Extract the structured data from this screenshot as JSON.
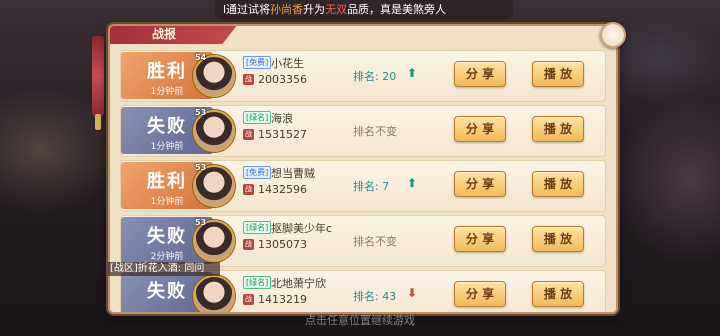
{
  "marquee": {
    "prefix": "l通过试",
    "middle": "将",
    "hero": "孙尚香",
    "mid2": "升为",
    "quality": "无双",
    "suffix": "品质，真是美煞旁人"
  },
  "panel": {
    "title": "战报"
  },
  "reports": [
    {
      "result": "胜利",
      "time": "1分钟前",
      "type": "win",
      "level": "54",
      "tag": "[免费]",
      "tag_color": "blue",
      "name": "小花生",
      "power": "2003356",
      "rank_text": "排名: 20",
      "rank_change": "up",
      "arrow": "⬆",
      "share": "分 享",
      "play": "播 放"
    },
    {
      "result": "失败",
      "time": "1分钟前",
      "type": "lose",
      "level": "53",
      "tag": "[绿名]",
      "tag_color": "green",
      "name": "海浪",
      "power": "1531527",
      "rank_text": "排名不变",
      "rank_change": "same",
      "arrow": "",
      "share": "分 享",
      "play": "播 放"
    },
    {
      "result": "胜利",
      "time": "1分钟前",
      "type": "win",
      "level": "53",
      "tag": "[免费]",
      "tag_color": "blue",
      "name": "想当曹贼",
      "power": "1432596",
      "rank_text": "排名: 7",
      "rank_change": "up",
      "arrow": "⬆",
      "share": "分 享",
      "play": "播 放"
    },
    {
      "result": "失败",
      "time": "2分钟前",
      "type": "lose",
      "level": "53",
      "tag": "[绿名]",
      "tag_color": "green",
      "name": "抠脚美少年c",
      "power": "1305073",
      "rank_text": "排名不变",
      "rank_change": "same",
      "arrow": "",
      "share": "分 享",
      "play": "播 放"
    },
    {
      "result": "失败",
      "time": "",
      "type": "lose",
      "level": "",
      "tag": "[绿名]",
      "tag_color": "green",
      "name": "北地萧宁欣",
      "power": "1413219",
      "rank_text": "排名: 43",
      "rank_change": "down",
      "arrow": "⬇",
      "share": "分 享",
      "play": "播 放"
    }
  ],
  "chat_overlay": "[战区]折花入酒: 同问",
  "bottom_hint": "点击任意位置继续游戏",
  "colors": {
    "win": "#d2733e",
    "lose": "#5d6890",
    "accent": "#f3b957",
    "rank_up": "#1b9b7c",
    "rank_down": "#d04a3a"
  }
}
